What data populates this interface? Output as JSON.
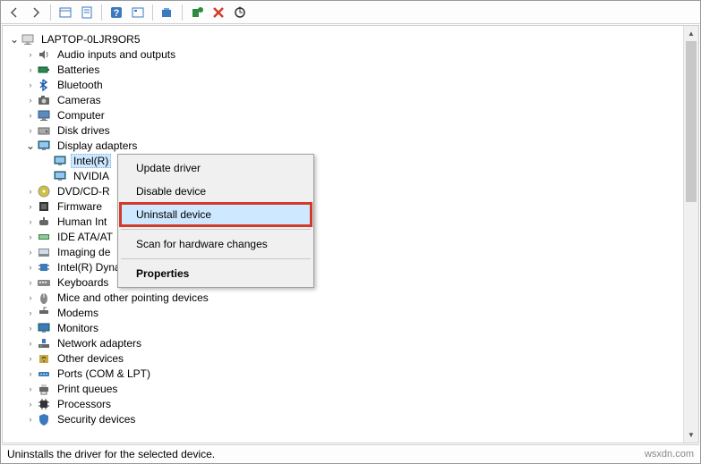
{
  "toolbar": {
    "back": "Back",
    "forward": "Forward",
    "show_hidden": "Show hidden",
    "properties": "Properties",
    "help": "Help",
    "events": "Events",
    "scan": "Scan",
    "add": "Add legacy",
    "remove": "Remove",
    "update": "Update"
  },
  "root": "LAPTOP-0LJR9OR5",
  "categories": [
    {
      "label": "Audio inputs and outputs",
      "expanded": false
    },
    {
      "label": "Batteries",
      "expanded": false
    },
    {
      "label": "Bluetooth",
      "expanded": false
    },
    {
      "label": "Cameras",
      "expanded": false
    },
    {
      "label": "Computer",
      "expanded": false
    },
    {
      "label": "Disk drives",
      "expanded": false
    },
    {
      "label": "Display adapters",
      "expanded": true,
      "children": [
        {
          "label": "Intel(R)",
          "selected": true
        },
        {
          "label": "NVIDIA",
          "selected": false
        }
      ]
    },
    {
      "label": "DVD/CD-R",
      "expanded": false
    },
    {
      "label": "Firmware",
      "expanded": false
    },
    {
      "label": "Human Int",
      "expanded": false
    },
    {
      "label": "IDE ATA/AT",
      "expanded": false
    },
    {
      "label": "Imaging de",
      "expanded": false
    },
    {
      "label": "Intel(R) Dynamic Platform and Thermal Framework",
      "expanded": false
    },
    {
      "label": "Keyboards",
      "expanded": false
    },
    {
      "label": "Mice and other pointing devices",
      "expanded": false
    },
    {
      "label": "Modems",
      "expanded": false
    },
    {
      "label": "Monitors",
      "expanded": false
    },
    {
      "label": "Network adapters",
      "expanded": false
    },
    {
      "label": "Other devices",
      "expanded": false
    },
    {
      "label": "Ports (COM & LPT)",
      "expanded": false
    },
    {
      "label": "Print queues",
      "expanded": false
    },
    {
      "label": "Processors",
      "expanded": false
    },
    {
      "label": "Security devices",
      "expanded": false
    }
  ],
  "context_menu": {
    "update": "Update driver",
    "disable": "Disable device",
    "uninstall": "Uninstall device",
    "scan": "Scan for hardware changes",
    "properties": "Properties"
  },
  "status": "Uninstalls the driver for the selected device.",
  "watermark": "wsxdn.com"
}
